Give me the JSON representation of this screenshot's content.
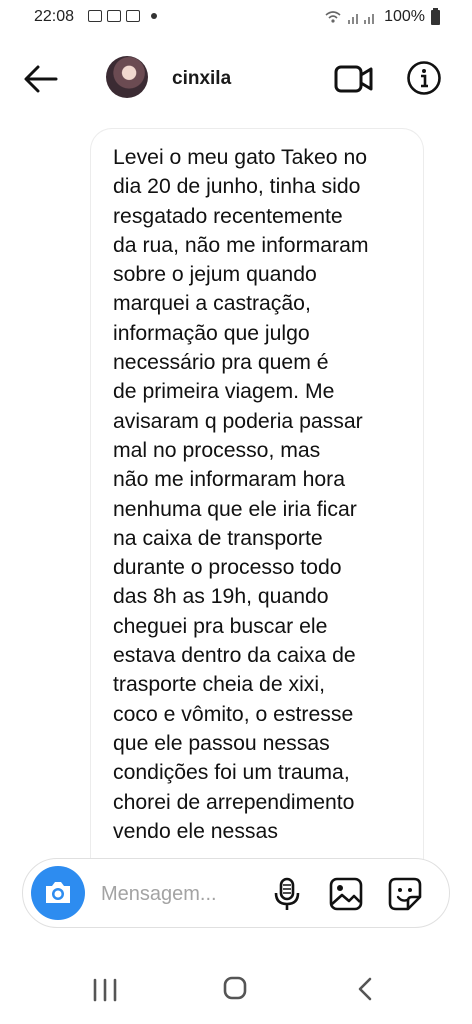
{
  "status_bar": {
    "time": "22:08",
    "battery": "100%"
  },
  "header": {
    "username": "cinxila"
  },
  "message": {
    "text": "Levei o meu gato Takeo no\ndia 20 de junho, tinha sido\nresgatado recentemente\nda rua, não me informaram\nsobre o jejum quando\nmarquei a castração,\ninformação que julgo\nnecessário pra quem é\nde primeira viagem. Me\navisaram q poderia passar\nmal no processo, mas\nnão me informaram hora\nnenhuma que ele iria ficar\nna caixa de transporte\ndurante o processo todo\ndas 8h as 19h, quando\ncheguei pra buscar ele\nestava dentro da caixa de\ntrasporte cheia de xixi,\ncoco e vômito, o estresse\nque ele passou nessas\ncondições foi um trauma,\nchorei de arrependimento\nvendo ele nessas"
  },
  "composer": {
    "placeholder": "Mensagem..."
  },
  "colors": {
    "accent": "#2d8cf0",
    "placeholder": "#a3a3a3"
  },
  "icons": [
    "back-arrow-icon",
    "video-call-icon",
    "info-icon",
    "camera-icon",
    "microphone-icon",
    "gallery-icon",
    "sticker-icon"
  ]
}
